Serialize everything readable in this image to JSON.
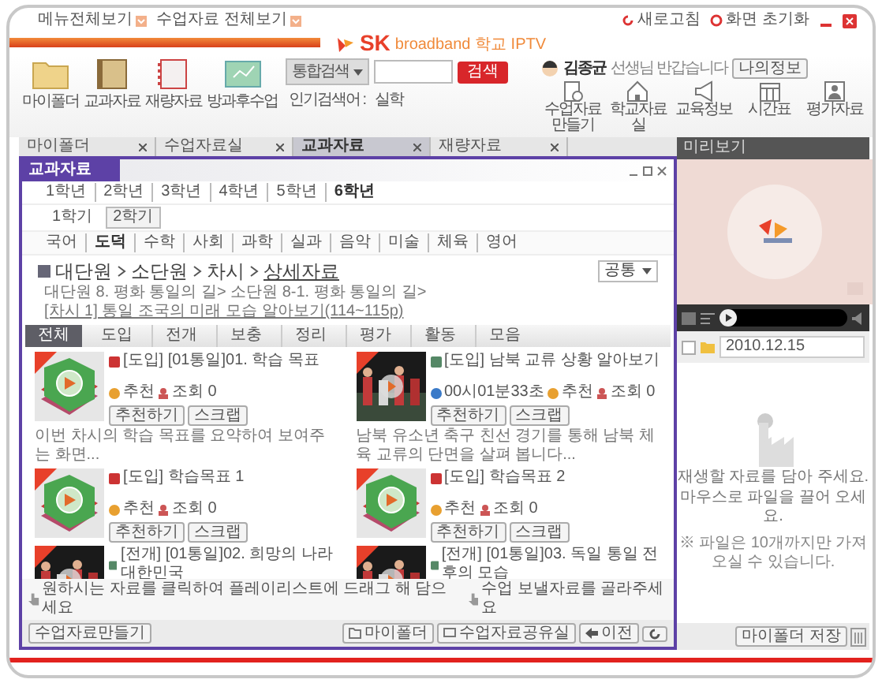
{
  "top_links": [
    "메뉴전체보기",
    "수업자료 전체보기"
  ],
  "logo": {
    "brand": "SK",
    "text": "broadband 학교 IPTV"
  },
  "window_links": [
    {
      "label": "새로고침",
      "kind": "refresh"
    },
    {
      "label": "화면 초기화",
      "kind": "reset"
    }
  ],
  "toolbar": [
    {
      "label": "마이폴더",
      "kind": "folder"
    },
    {
      "label": "교과자료",
      "kind": "book"
    },
    {
      "label": "재량자료",
      "kind": "notebook"
    },
    {
      "label": "방과후수업",
      "kind": "board"
    }
  ],
  "search": {
    "scope": "통합검색",
    "button": "검색",
    "popular_label": "인기검색어 :",
    "popular": [
      "실학"
    ]
  },
  "user": {
    "name": "김종균",
    "greeting": "선생님 반갑습니다",
    "button": "나의정보"
  },
  "quick": [
    {
      "label": "수업자료만들기",
      "kind": "doc"
    },
    {
      "label": "학교자료실",
      "kind": "school"
    },
    {
      "label": "교육정보",
      "kind": "megaphone"
    },
    {
      "label": "시간표",
      "kind": "calendar"
    },
    {
      "label": "평가자료",
      "kind": "person"
    }
  ],
  "tabs": [
    {
      "label": "마이폴더",
      "selected": false
    },
    {
      "label": "수업자료실",
      "selected": false
    },
    {
      "label": "교과자료",
      "selected": true
    },
    {
      "label": "재량자료",
      "selected": false
    }
  ],
  "panel": {
    "title": "교과자료",
    "grades": [
      {
        "label": "1학년",
        "selected": false
      },
      {
        "label": "2학년",
        "selected": false
      },
      {
        "label": "3학년",
        "selected": false
      },
      {
        "label": "4학년",
        "selected": false
      },
      {
        "label": "5학년",
        "selected": false
      },
      {
        "label": "6학년",
        "selected": true
      }
    ],
    "semesters": [
      {
        "label": "1학기",
        "selected": false
      },
      {
        "label": "2학기",
        "selected": true
      }
    ],
    "subjects": [
      {
        "label": "국어",
        "selected": false
      },
      {
        "label": "도덕",
        "selected": true
      },
      {
        "label": "수학",
        "selected": false
      },
      {
        "label": "사회",
        "selected": false
      },
      {
        "label": "과학",
        "selected": false
      },
      {
        "label": "실과",
        "selected": false
      },
      {
        "label": "음악",
        "selected": false
      },
      {
        "label": "미술",
        "selected": false
      },
      {
        "label": "체육",
        "selected": false
      },
      {
        "label": "영어",
        "selected": false
      }
    ],
    "breadcrumb": [
      "대단원",
      "소단원",
      "차시",
      "상세자료"
    ],
    "filter_select": "공통",
    "path": "대단원 8. 평화 통일의 길> 소단원 8-1. 평화 통일의 길>",
    "path_link": "[차시 1] 통일 조국의 미래 모습 알아보기(114~115p)",
    "filters": [
      {
        "label": "전체",
        "selected": true
      },
      {
        "label": "도입",
        "selected": false
      },
      {
        "label": "전개",
        "selected": false
      },
      {
        "label": "보충",
        "selected": false
      },
      {
        "label": "정리",
        "selected": false
      },
      {
        "label": "평가",
        "selected": false
      },
      {
        "label": "활동",
        "selected": false
      },
      {
        "label": "모음",
        "selected": false
      }
    ],
    "items": [
      {
        "kind": "book",
        "title": "[도입] [01통일]01. 학습 목표",
        "recommend": "추천",
        "views": "조회 0",
        "actions": [
          "추천하기",
          "스크랩"
        ],
        "description": "이번 차시의 학습 목표를 요약하여 보여주는 화면..."
      },
      {
        "kind": "video",
        "title": "[도입] 남북 교류 상황 알아보기",
        "duration": "00시01분33초",
        "recommend": "추천",
        "views": "조회 0",
        "actions": [
          "추천하기",
          "스크랩"
        ],
        "description": "남북 유소년 축구 친선 경기를 통해 남북 체육 교류의 단면을 살펴 봅니다..."
      },
      {
        "kind": "book",
        "title": "[도입] 학습목표 1",
        "recommend": "추천",
        "views": "조회 0",
        "actions": [
          "추천하기",
          "스크랩"
        ]
      },
      {
        "kind": "book",
        "title": "[도입] 학습목표 2",
        "recommend": "추천",
        "views": "조회 0",
        "actions": [
          "추천하기",
          "스크랩"
        ]
      },
      {
        "kind": "video",
        "title": "[전개] [01통일]02. 희망의 나라 대한민국"
      },
      {
        "kind": "video",
        "title": "[전개] [01통일]03. 독일 통일 전후의 모습"
      }
    ],
    "hints": [
      "원하시는 자료를 클릭하여 플레이리스트에 드래그 해 담으세요",
      "수업 보낼자료를 골라주세요"
    ],
    "footer_left": "수업자료만들기",
    "footer_buttons": [
      {
        "label": "마이폴더",
        "kind": "folder"
      },
      {
        "label": "수업자료공유실",
        "kind": "share"
      },
      {
        "label": "이전",
        "kind": "back"
      },
      {
        "kind": "refresh"
      }
    ]
  },
  "preview": {
    "title": "미리보기",
    "level": 0,
    "checked": false,
    "date": "2010.12.15",
    "empty_lines": [
      "재생할 자료를 담아 주세요.",
      "마우스로 파일을 끌어 오세요."
    ],
    "note": "※ 파일은 10개까지만 가져오실 수 있습니다.",
    "save_button": "마이폴더 저장"
  }
}
